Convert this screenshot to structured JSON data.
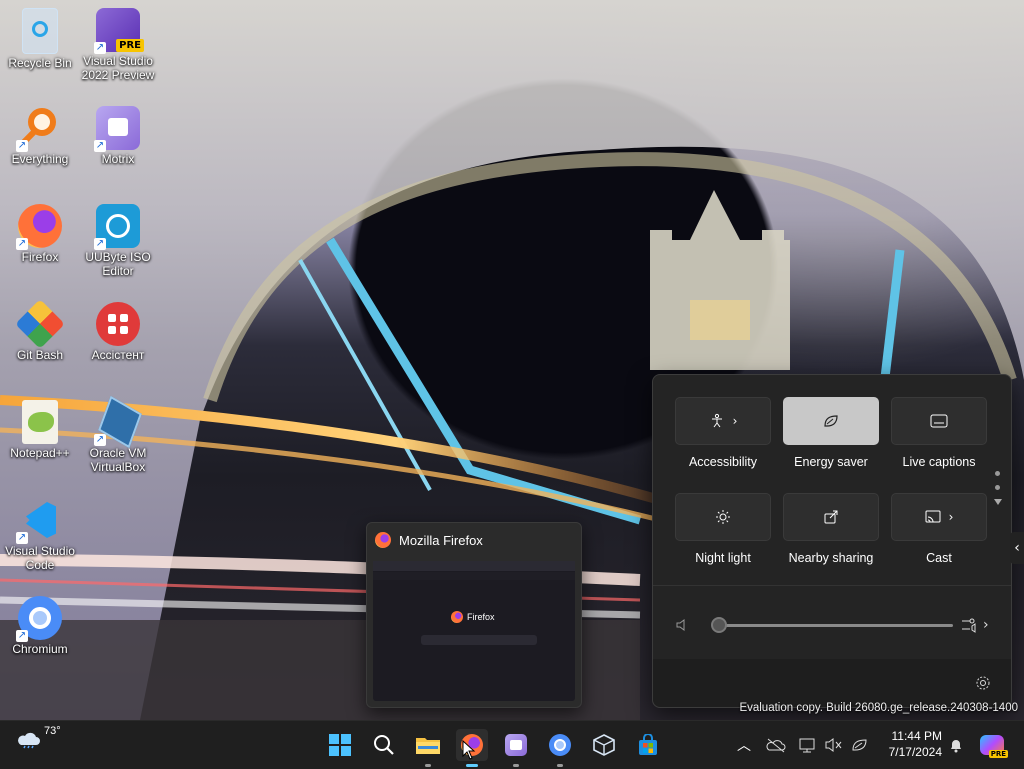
{
  "desktop": {
    "icons": [
      {
        "label": "Recycle Bin"
      },
      {
        "label": "Visual Studio 2022 Preview",
        "badge": "PRE"
      },
      {
        "label": "Everything"
      },
      {
        "label": "Motrix"
      },
      {
        "label": "Firefox"
      },
      {
        "label": "UUByte ISO Editor"
      },
      {
        "label": "Git Bash"
      },
      {
        "label": "Accicтент"
      },
      {
        "label": "Notepad++"
      },
      {
        "label": "Oracle VM VirtualBox"
      },
      {
        "label": "Visual Studio Code"
      },
      {
        "label": "Chromium"
      }
    ]
  },
  "firefox_preview": {
    "title": "Mozilla Firefox",
    "thumbnail_text": "Firefox"
  },
  "quick_settings": {
    "tiles": [
      {
        "label": "Accessibility",
        "icon": "accessibility-icon",
        "has_chevron": true,
        "active": false
      },
      {
        "label": "Energy saver",
        "icon": "leaf-icon",
        "has_chevron": false,
        "active": true
      },
      {
        "label": "Live captions",
        "icon": "captions-icon",
        "has_chevron": false,
        "active": false
      },
      {
        "label": "Night light",
        "icon": "brightness-icon",
        "has_chevron": false,
        "active": false
      },
      {
        "label": "Nearby sharing",
        "icon": "share-icon",
        "has_chevron": false,
        "active": false
      },
      {
        "label": "Cast",
        "icon": "cast-icon",
        "has_chevron": true,
        "active": false
      }
    ],
    "volume_level": 0
  },
  "watermark": "Evaluation copy. Build 26080.ge_release.240308-1400",
  "taskbar": {
    "weather_temp": "73°",
    "clock_time": "11:44 PM",
    "clock_date": "7/17/2024",
    "accent": "#60cdff"
  }
}
